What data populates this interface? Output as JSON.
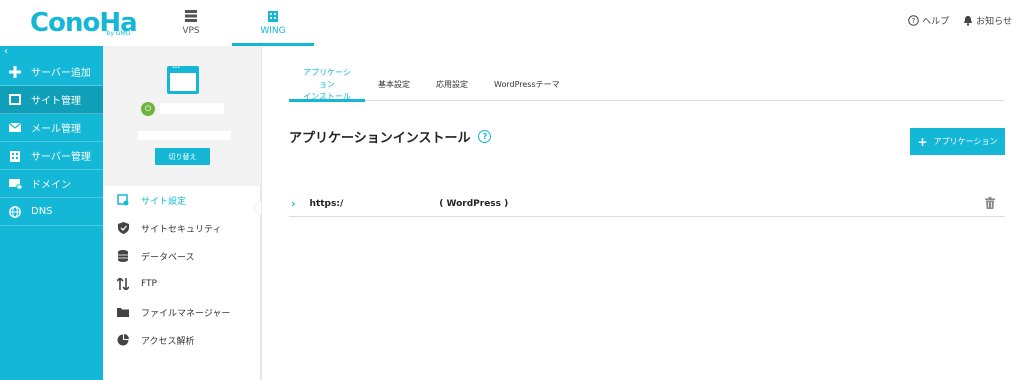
{
  "brand": {
    "logo_text": "ConoHa",
    "logo_sub": "by GMO"
  },
  "top_nav": [
    {
      "label": "VPS",
      "icon": "server-icon"
    },
    {
      "label": "WING",
      "icon": "building-icon"
    }
  ],
  "header_right": {
    "help": "ヘルプ",
    "notice": "お知らせ"
  },
  "sidebar": {
    "collapse": "‹",
    "items": [
      {
        "label": "サーバー追加",
        "icon": "plus-icon"
      },
      {
        "label": "サイト管理",
        "icon": "window-icon"
      },
      {
        "label": "メール管理",
        "icon": "mail-icon"
      },
      {
        "label": "サーバー管理",
        "icon": "building-icon"
      },
      {
        "label": "ドメイン",
        "icon": "domain-icon"
      },
      {
        "label": "DNS",
        "icon": "globe-icon"
      }
    ]
  },
  "site_panel": {
    "switch_label": "切り替え"
  },
  "sub_menu": [
    {
      "label": "サイト設定",
      "icon": "settings-icon"
    },
    {
      "label": "サイトセキュリティ",
      "icon": "shield-icon"
    },
    {
      "label": "データベース",
      "icon": "database-icon"
    },
    {
      "label": "FTP",
      "icon": "transfer-icon"
    },
    {
      "label": "ファイルマネージャー",
      "icon": "folder-icon"
    },
    {
      "label": "アクセス解析",
      "icon": "pie-icon"
    }
  ],
  "tabs": [
    {
      "line1": "アプリケーション",
      "line2": "インストール"
    },
    {
      "line1": "基本設定",
      "line2": ""
    },
    {
      "line1": "応用設定",
      "line2": ""
    },
    {
      "line1": "WordPressテーマ",
      "line2": ""
    }
  ],
  "main": {
    "title": "アプリケーションインストール",
    "help": "?",
    "add_button": "アプリケーション",
    "row": {
      "url": "https:/",
      "type": "( WordPress )"
    }
  },
  "colors": {
    "accent": "#14b8d6",
    "active_nav": "#0f9fb9",
    "power": "#6db33f"
  }
}
